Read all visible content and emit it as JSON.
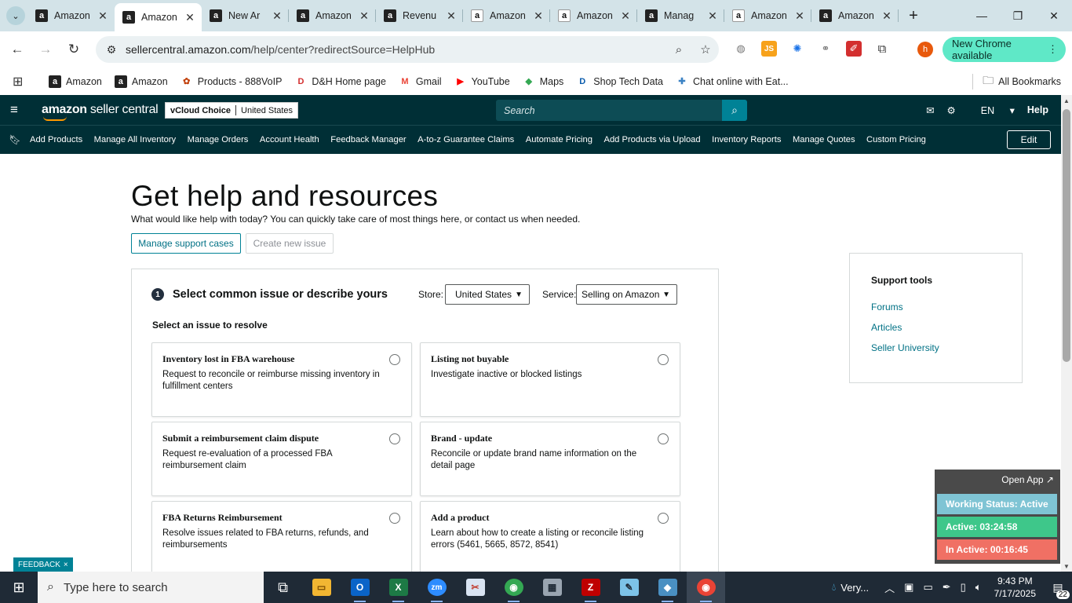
{
  "browser": {
    "tabs": [
      {
        "title": "Amazon",
        "favicon": "a",
        "style": "dark",
        "active": false
      },
      {
        "title": "Amazon",
        "favicon": "a",
        "style": "dark",
        "active": true
      },
      {
        "title": "New Ar",
        "favicon": "a",
        "style": "dark",
        "active": false
      },
      {
        "title": "Amazon",
        "favicon": "a",
        "style": "dark",
        "active": false
      },
      {
        "title": "Revenu",
        "favicon": "a",
        "style": "dark",
        "active": false
      },
      {
        "title": "Amazon",
        "favicon": "a",
        "style": "light",
        "active": false
      },
      {
        "title": "Amazon",
        "favicon": "a",
        "style": "light",
        "active": false
      },
      {
        "title": "Manag",
        "favicon": "a",
        "style": "dark",
        "active": false
      },
      {
        "title": "Amazon",
        "favicon": "a",
        "style": "light",
        "active": false
      },
      {
        "title": "Amazon",
        "favicon": "a",
        "style": "dark",
        "active": false
      }
    ],
    "url_host": "sellercentral.amazon.com",
    "url_path": "/help/center?redirectSource=HelpHub",
    "profile_initial": "h",
    "new_chrome_label": "New Chrome available",
    "bookmarks": [
      {
        "label": "Amazon",
        "icon": "a",
        "color": "#222222"
      },
      {
        "label": "Amazon",
        "icon": "a",
        "color": "#222222"
      },
      {
        "label": "Products - 888VoIP",
        "icon": "✿",
        "color": "#c2410c"
      },
      {
        "label": "D&H Home page",
        "icon": "D",
        "color": "#d32f2f"
      },
      {
        "label": "Gmail",
        "icon": "M",
        "color": "#ea4335"
      },
      {
        "label": "YouTube",
        "icon": "▶",
        "color": "#ff0000"
      },
      {
        "label": "Maps",
        "icon": "◆",
        "color": "#34a853"
      },
      {
        "label": "Shop Tech Data",
        "icon": "D",
        "color": "#0b5cad"
      },
      {
        "label": "Chat online with Eat...",
        "icon": "✚",
        "color": "#3b82c4"
      }
    ],
    "all_bookmarks_label": "All Bookmarks"
  },
  "header": {
    "logo_bold": "amazon",
    "logo_light": " seller central",
    "account_name": "vCloud Choice",
    "account_region": "United States",
    "search_placeholder": "Search",
    "language": "EN",
    "help_label": "Help",
    "nav_links": [
      "Add Products",
      "Manage All Inventory",
      "Manage Orders",
      "Account Health",
      "Feedback Manager",
      "A-to-z Guarantee Claims",
      "Automate Pricing",
      "Add Products via Upload",
      "Inventory Reports",
      "Manage Quotes",
      "Custom Pricing"
    ],
    "edit_label": "Edit"
  },
  "main": {
    "title": "Get help and resources",
    "subtitle": "What would like help with today? You can quickly take care of most things here, or contact us when needed.",
    "manage_cases_label": "Manage support cases",
    "create_issue_label": "Create new issue",
    "step_number": "1",
    "step_title": "Select common issue or describe yours",
    "store_label": "Store:",
    "store_value": "United States",
    "service_label": "Service:",
    "service_value": "Selling on Amazon",
    "section_label": "Select an issue to resolve",
    "issues": [
      {
        "title": "Inventory lost in FBA warehouse",
        "desc": "Request to reconcile or reimburse missing inventory in fulfillment centers"
      },
      {
        "title": "Listing not buyable",
        "desc": "Investigate inactive or blocked listings"
      },
      {
        "title": "Submit a reimbursement claim dispute",
        "desc": "Request re-evaluation of a processed FBA reimbursement claim"
      },
      {
        "title": "Brand - update",
        "desc": "Reconcile or update brand name information on the detail page"
      },
      {
        "title": "FBA Returns Reimbursement",
        "desc": "Resolve issues related to FBA returns, refunds, and reimbursements"
      },
      {
        "title": "Add a product",
        "desc": "Learn about how to create a listing or reconcile listing errors (5461, 5665, 8572, 8541)"
      }
    ]
  },
  "support_tools": {
    "title": "Support tools",
    "links": [
      "Forums",
      "Articles",
      "Seller University"
    ]
  },
  "feedback_label": "FEEDBACK",
  "widget": {
    "open_app_label": "Open App ↗",
    "working_status": "Working Status: Active",
    "active_time": "Active: 03:24:58",
    "inactive_time": "In Active: 00:16:45",
    "colors": {
      "status": "#7fc4d4",
      "active": "#3ec78a",
      "inactive": "#f07064"
    }
  },
  "taskbar": {
    "search_placeholder": "Type here to search",
    "weather_label": "Very...",
    "time": "9:43 PM",
    "date": "7/17/2025",
    "notification_count": "22"
  },
  "colors": {
    "amazon_header": "#002f36",
    "accent": "#008296",
    "link": "#007185"
  }
}
